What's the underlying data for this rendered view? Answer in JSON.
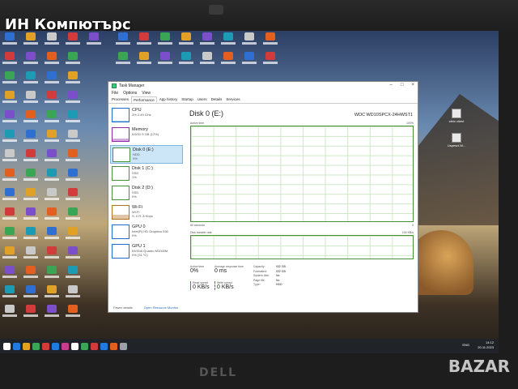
{
  "overlay_title": "ИН Компютърс",
  "desktop_right_icons": [
    "citrix client",
    "Uspesni M..."
  ],
  "window": {
    "title": "Task Manager",
    "menu": [
      "File",
      "Options",
      "View"
    ],
    "tabs": [
      "Processes",
      "Performance",
      "App history",
      "Startup",
      "Users",
      "Details",
      "Services"
    ],
    "active_tab": "Performance"
  },
  "sidebar": [
    {
      "name": "CPU",
      "sub": "3% 2.49 GHz",
      "color": "#1a73c9",
      "level": 0.05
    },
    {
      "name": "Memory",
      "sub": "5.6/31.9 GB (17%)",
      "color": "#8e2aa8",
      "level": 0.17
    },
    {
      "name": "Disk 0 (E:)",
      "sub": "HDD\n0%",
      "color": "#4a8f3c",
      "level": 0.0,
      "active": true
    },
    {
      "name": "Disk 1 (C:)",
      "sub": "SSD\n1%",
      "color": "#4a8f3c",
      "level": 0.02
    },
    {
      "name": "Disk 2 (D:)",
      "sub": "SSD\n0%",
      "color": "#4a8f3c",
      "level": 0.0
    },
    {
      "name": "Wi-Fi",
      "sub": "Wi-Fi\nS: 0 R: 8 Kbps",
      "color": "#b0701f",
      "level": 0.3
    },
    {
      "name": "GPU 0",
      "sub": "Intel(R) HD Graphics 530\n0%",
      "color": "#1a73c9",
      "level": 0.0
    },
    {
      "name": "GPU 1",
      "sub": "NVIDIA Quadro M1000M\n0% (31 °C)",
      "color": "#1a73c9",
      "level": 0.0
    }
  ],
  "main": {
    "disk_title": "Disk 0 (E:)",
    "model": "WDC WD10SPCX-24HWST1",
    "active_time_label": "Active time",
    "active_time_max": "100%",
    "seconds_label": "60 seconds",
    "zero_label": "0",
    "transfer_label": "Disk transfer rate",
    "transfer_max": "100 KB/s",
    "stats": {
      "active_time_k": "Active time",
      "active_time_v": "0%",
      "response_k": "Average response time",
      "response_v": "0 ms",
      "read_k": "Read speed",
      "read_v": "0 KB/s",
      "write_k": "Write speed",
      "write_v": "0 KB/s"
    },
    "props_labels": [
      "Capacity:",
      "Formatted:",
      "System disk:",
      "Page file:",
      "Type:"
    ],
    "props_values": [
      "932 GB",
      "932 GB",
      "No",
      "No",
      "HDD"
    ]
  },
  "footer": {
    "fewer": "Fewer details",
    "monitor": "Open Resource Monitor"
  },
  "tray": {
    "lang": "ENG",
    "time": "14:12",
    "date": "20.11.2023"
  },
  "brand_bottom": "DELL",
  "watermark": "BAZAR"
}
